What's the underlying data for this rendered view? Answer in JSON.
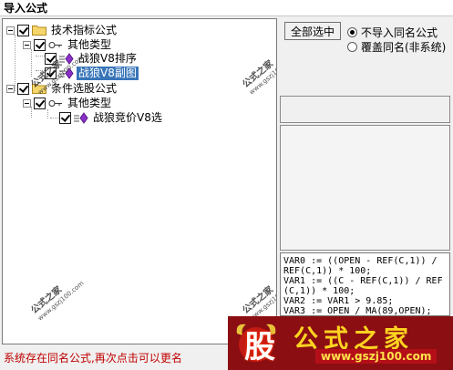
{
  "window": {
    "title": "导入公式"
  },
  "tree": {
    "root1": {
      "label": "技术指标公式"
    },
    "root1_child": {
      "label": "其他类型"
    },
    "item1": {
      "label": "战狼V8排序"
    },
    "item2": {
      "label": "战狼V8副图"
    },
    "root2": {
      "label": "条件选股公式"
    },
    "root2_child": {
      "label": "其他类型"
    },
    "item3": {
      "label": "战狼竞价V8选"
    }
  },
  "actions": {
    "select_all_label": "全部选中"
  },
  "options": {
    "no_import_label": "不导入同名公式",
    "overwrite_label": "覆盖同名(非系统)",
    "selected": "不导入同名公式"
  },
  "code": {
    "text": "VAR0 := ((OPEN - REF(C,1)) / REF(C,1)) * 100;\nVAR1 := ((C - REF(C,1)) / REF(C,1)) * 100;\nVAR2 := VAR1 > 9.85;\nVAR3 := OPEN / MA(89,OPEN);"
  },
  "status": {
    "text": "系统存在同名公式,再次点击可以更名"
  },
  "watermark": {
    "brand": "公式之家",
    "url": "www.gszj100.com",
    "logo_char": "股"
  },
  "colors": {
    "selection": "#3875b9",
    "status_text": "#c00000",
    "banner_bg": "#8a0e12",
    "brand_text": "#ffd320"
  }
}
